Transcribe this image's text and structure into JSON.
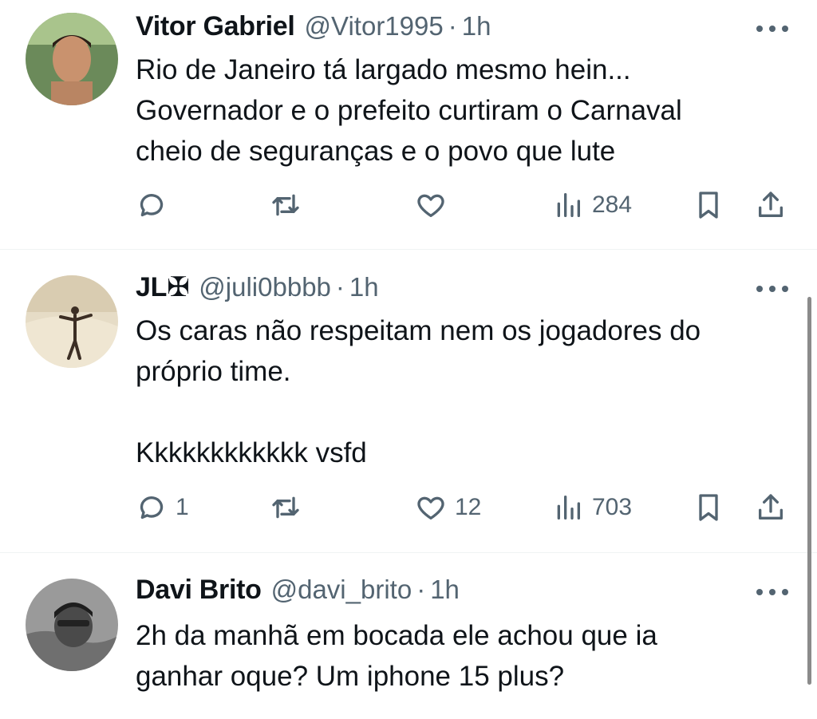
{
  "tweets": [
    {
      "name": "Vitor Gabriel",
      "handle": "@Vitor1995",
      "separator": "·",
      "time": "1h",
      "lines": [
        "Rio de Janeiro tá largado mesmo hein...",
        "Governador e o prefeito curtiram o Carnaval",
        "cheio de seguranças e o povo que lute"
      ],
      "replies": "",
      "retweets": "",
      "likes": "",
      "views": "284"
    },
    {
      "name": "JL✠",
      "handle": "@juli0bbbb",
      "separator": "·",
      "time": "1h",
      "lines": [
        "Os caras não respeitam nem os jogadores do",
        "próprio time.",
        "",
        "Kkkkkkkkkkkk vsfd"
      ],
      "replies": "1",
      "retweets": "",
      "likes": "12",
      "views": "703"
    },
    {
      "name": "Davi Brito",
      "handle": "@davi_brito",
      "separator": "·",
      "time": "1h",
      "lines": [
        "2h da manhã em bocada ele achou que ia",
        "ganhar oque? Um iphone 15 plus?"
      ]
    }
  ],
  "icons": {
    "reply": "reply-icon",
    "retweet": "retweet-icon",
    "like": "heart-icon",
    "views": "views-icon",
    "bookmark": "bookmark-icon",
    "share": "share-icon",
    "more": "more-icon"
  },
  "colors": {
    "text": "#0f1419",
    "secondary": "#536471",
    "divider": "#eff3f4"
  }
}
